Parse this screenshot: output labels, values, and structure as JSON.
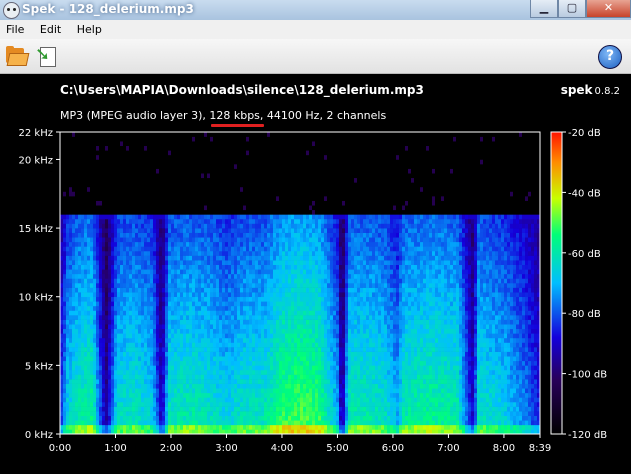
{
  "window": {
    "title": "Spek - 128_delerium.mp3",
    "minimize": "▁",
    "maximize": "▢",
    "close": "✕"
  },
  "menu": {
    "items": [
      "File",
      "Edit",
      "Help"
    ]
  },
  "toolbar": {
    "open_icon": "folder-open-icon",
    "save_icon": "save-icon",
    "help_icon": "help-icon",
    "help_label": "?"
  },
  "header": {
    "file_path": "C:\\Users\\MAPIA\\Downloads\\silence\\128_delerium.mp3",
    "app_name": "spek",
    "version": "0.8.2",
    "audio_info_prefix": "MP3 (MPEG audio layer 3), ",
    "bitrate": "128 kbps",
    "audio_info_suffix": ", 44100 Hz, 2 channels"
  },
  "colors": {
    "annotation_underline": "#e02020",
    "background": "#000000"
  },
  "chart_data": {
    "type": "heatmap",
    "x_ticks": [
      "0:00",
      "1:00",
      "2:00",
      "3:00",
      "4:00",
      "5:00",
      "6:00",
      "7:00",
      "8:00",
      "8:39"
    ],
    "x_tick_seconds": [
      0,
      60,
      120,
      180,
      240,
      300,
      360,
      420,
      480,
      519
    ],
    "x_range_seconds": [
      0,
      519
    ],
    "y_ticks": [
      "0 kHz",
      "5 kHz",
      "10 kHz",
      "15 kHz",
      "20 kHz",
      "22 kHz"
    ],
    "y_tick_khz": [
      0,
      5,
      10,
      15,
      20,
      22
    ],
    "y_range_khz": [
      0,
      22
    ],
    "legend_ticks": [
      "-20 dB",
      "-40 dB",
      "-60 dB",
      "-80 dB",
      "-100 dB",
      "-120 dB"
    ],
    "legend_tick_db": [
      -20,
      -40,
      -60,
      -80,
      -100,
      -120
    ],
    "legend_range_db": [
      -120,
      -20
    ],
    "legend_placement": "right",
    "lowpass_cutoff_khz": 16,
    "quiet_segments_seconds": [
      [
        50,
        62
      ],
      [
        110,
        118
      ],
      [
        305,
        312
      ],
      [
        447,
        452
      ]
    ],
    "energy_profile": [
      [
        0,
        0.35
      ],
      [
        8,
        0.55
      ],
      [
        20,
        0.62
      ],
      [
        35,
        0.65
      ],
      [
        50,
        0.25
      ],
      [
        62,
        0.58
      ],
      [
        80,
        0.6
      ],
      [
        100,
        0.55
      ],
      [
        110,
        0.28
      ],
      [
        118,
        0.6
      ],
      [
        140,
        0.62
      ],
      [
        160,
        0.6
      ],
      [
        180,
        0.55
      ],
      [
        200,
        0.6
      ],
      [
        220,
        0.6
      ],
      [
        240,
        0.7
      ],
      [
        260,
        0.72
      ],
      [
        280,
        0.7
      ],
      [
        300,
        0.5
      ],
      [
        305,
        0.22
      ],
      [
        312,
        0.62
      ],
      [
        330,
        0.62
      ],
      [
        350,
        0.6
      ],
      [
        365,
        0.5
      ],
      [
        372,
        0.62
      ],
      [
        400,
        0.65
      ],
      [
        430,
        0.62
      ],
      [
        447,
        0.3
      ],
      [
        452,
        0.6
      ],
      [
        480,
        0.55
      ],
      [
        505,
        0.45
      ],
      [
        519,
        0.35
      ]
    ]
  }
}
